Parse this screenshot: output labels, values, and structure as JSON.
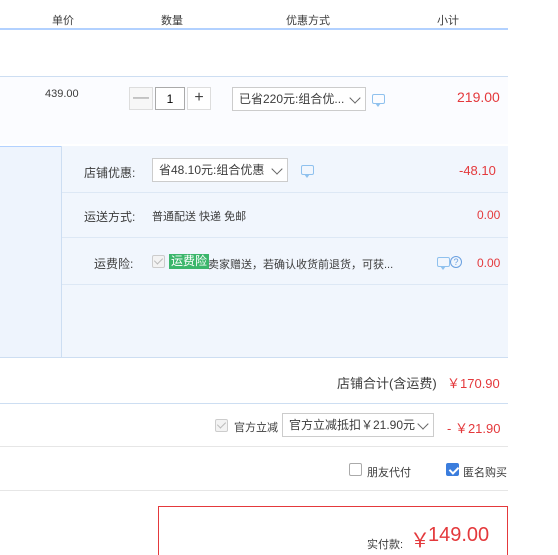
{
  "header": {
    "price_col": "单价",
    "qty_col": "数量",
    "discount_col": "优惠方式",
    "subtotal_col": "小计"
  },
  "item": {
    "unit_price": "439.00",
    "quantity": "1",
    "minus": "—",
    "plus": "+",
    "discount_selected": "已省220元:组合优...",
    "subtotal": "219.00"
  },
  "shop": {
    "discount_label": "店铺优惠:",
    "discount_selected": "省48.10元:组合优惠",
    "discount_value": "-48.10",
    "shipping_label": "运送方式:",
    "shipping_text": "普通配送 快递 免邮",
    "shipping_value": "0.00",
    "insurance_label": "运费险:",
    "insurance_badge": "运费险",
    "insurance_text": "卖家赠送，若确认收货前退货，可获...",
    "insurance_value": "0.00",
    "total_label": "店铺合计(含运费)",
    "total_value": "￥170.90"
  },
  "official": {
    "label": "官方立减",
    "selected": "官方立减抵扣￥21.90元",
    "value": "- ￥21.90"
  },
  "options": {
    "friend_pay": "朋友代付",
    "anonymous": "匿名购买"
  },
  "payment": {
    "label": "实付款:",
    "currency": "￥",
    "amount": "149.00"
  },
  "colors": {
    "accent_red": "#e4393c",
    "border_blue": "#b2d1ff",
    "badge_green": "#3bb66b"
  }
}
